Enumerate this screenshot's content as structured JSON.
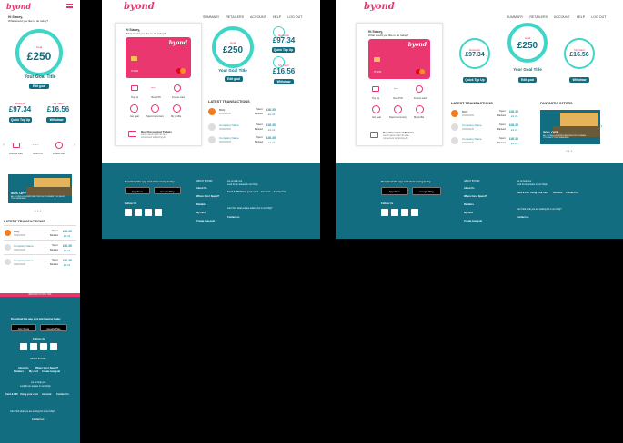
{
  "brand": {
    "logo": "byond",
    "accent": "#e8336d",
    "teal": "#126d80",
    "ring": "#3fd6c8"
  },
  "nav": [
    "SUMMARY",
    "RETAILERS",
    "ACCOUNT",
    "HELP",
    "LOG OUT"
  ],
  "greeting": {
    "title": "Hi Stacey,",
    "subtitle": "What would you like to do today?"
  },
  "card": {
    "number": "0*1234"
  },
  "goal": {
    "label": "Goal",
    "amount": "£250",
    "title": "Your Goal Title",
    "edit": "Edit goal"
  },
  "balances": {
    "rewards_label": "Rewards",
    "rewards": "£97.34",
    "topup": "Quick Top Up",
    "myvault_label": "My Vault",
    "myvault": "£16.56",
    "withdraw": "Withdraw"
  },
  "actions": [
    {
      "label": "Top Up",
      "icon": "topup-icon"
    },
    {
      "label": "View PIN",
      "icon": "pin-icon"
    },
    {
      "label": "Freeze card",
      "icon": "snowflake-icon"
    },
    {
      "label": "Get goal",
      "icon": "goal-icon"
    },
    {
      "label": "Spend summary",
      "icon": "summary-icon"
    },
    {
      "label": "My profile",
      "icon": "profile-icon"
    }
  ],
  "mobile_actions": [
    "Activate card",
    "View PIN",
    "Freeze card"
  ],
  "discount": {
    "title": "Buy Discounted Tickets",
    "text": "Lorem ipsum dolor sit amet, consectetur adipiscing elit"
  },
  "transactions": {
    "heading": "LATEST TRANSACTIONS",
    "rows": [
      {
        "name": "B&Q",
        "date": "02/03/2020",
        "spent_label": "Spent",
        "spent": "£40.35",
        "banked_label": "Banked",
        "banked": "£1.31",
        "logo": true
      },
      {
        "name": "Company Name",
        "date": "02/03/2020",
        "spent_label": "Spent",
        "spent": "£40.35",
        "banked_label": "Banked",
        "banked": "£1.21",
        "logo": false
      },
      {
        "name": "Company Name",
        "date": "02/03/2020",
        "spent_label": "Spent",
        "spent": "£40.35",
        "banked_label": "Banked",
        "banked": "£1.21",
        "logo": false
      }
    ]
  },
  "offers": {
    "heading": "FANTASTIC OFFERS",
    "percent": "50% OFF",
    "text": "ALL LIVING & FURNITURE PRODUCTS WHEN YOU SHOP THIS WEEKEND"
  },
  "return_top": "RETURN TO THE TOP",
  "footer": {
    "download": "Download the app and start saving today",
    "appstore": "App Store",
    "googleplay": "Google Play",
    "follow": "Follow Us",
    "about_heading": "ABOUT BYOND",
    "links_col1": [
      "About Us",
      "Where Can I Spend?",
      "Retailers",
      "My card",
      "Create new goal"
    ],
    "help_lines": [
      "Let us help you",
      "Look for an answer in our FAQs"
    ],
    "links_col2": [
      "Card & PIN",
      "Using your card",
      "Account",
      "Contact Us"
    ],
    "cant_find": "Can't find what you are looking for in our FAQ?",
    "contact": "Contact us"
  }
}
